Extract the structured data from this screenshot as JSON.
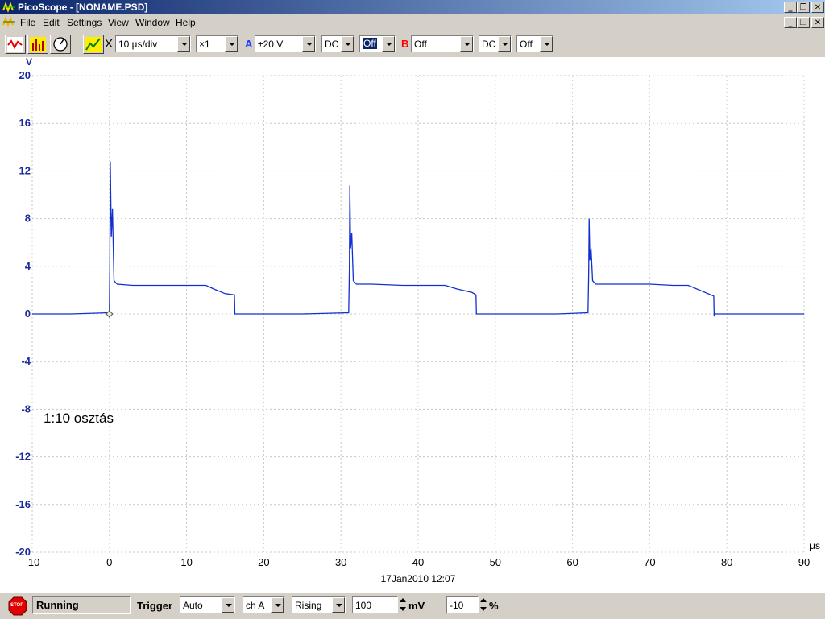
{
  "window": {
    "title": "PicoScope - [NONAME.PSD]",
    "controls": {
      "minimize": "_",
      "restore": "❐",
      "close": "✕"
    }
  },
  "menu": {
    "items": [
      "File",
      "Edit",
      "Settings",
      "View",
      "Window",
      "Help"
    ]
  },
  "toolbar": {
    "timebase_marker": "X",
    "timebase": "10 µs/div",
    "zoom": "×1",
    "channel_a": {
      "label": "A",
      "color": "#1a3cff",
      "range": "±20 V",
      "coupling": "DC",
      "option": "Off"
    },
    "channel_b": {
      "label": "B",
      "color": "#ff0000",
      "range": "Off",
      "coupling": "DC",
      "option": "Off"
    }
  },
  "chart_data": {
    "type": "line",
    "y_unit": "V",
    "x_unit": "µs",
    "xlim": [
      -10,
      90
    ],
    "ylim": [
      -20,
      20
    ],
    "x_ticks": [
      -10,
      0,
      10,
      20,
      30,
      40,
      50,
      60,
      70,
      80,
      90
    ],
    "y_ticks": [
      20,
      16,
      12,
      8,
      4,
      0,
      -4,
      -8,
      -12,
      -16,
      -20
    ],
    "grid": true,
    "annotation": "1:10 osztás",
    "timestamp": "17Jan2010  12:07",
    "trigger_marker": {
      "x": 0,
      "y": 0
    },
    "series": [
      {
        "color": "#1030d0",
        "x": [
          -10,
          -5,
          0,
          0.05,
          0.12,
          0.25,
          0.4,
          0.6,
          1,
          3,
          6,
          10,
          12.5,
          13.5,
          15,
          16.2,
          16.25,
          20,
          25,
          31,
          31.1,
          31.15,
          31.25,
          31.4,
          31.6,
          32,
          34,
          38,
          42,
          43.5,
          45,
          47,
          47.5,
          47.55,
          52,
          58,
          62,
          62.1,
          62.15,
          62.25,
          62.4,
          62.6,
          63,
          65,
          70,
          73,
          75,
          78.3,
          78.35,
          78.5,
          80,
          85,
          90
        ],
        "y": [
          0,
          0,
          0.1,
          4,
          12.8,
          6.5,
          8.8,
          2.8,
          2.5,
          2.4,
          2.4,
          2.4,
          2.4,
          2.1,
          1.7,
          1.6,
          0,
          0,
          0,
          0.1,
          4,
          10.8,
          5.5,
          6.8,
          2.8,
          2.5,
          2.5,
          2.4,
          2.4,
          2.4,
          2.1,
          1.8,
          1.6,
          0,
          0,
          0,
          0.1,
          3.5,
          8,
          4.5,
          5.5,
          2.8,
          2.5,
          2.5,
          2.5,
          2.4,
          2.4,
          1.5,
          -0.2,
          0,
          0,
          0,
          0
        ]
      }
    ]
  },
  "status": {
    "stop_icon_text": "STOP",
    "run_state": "Running",
    "trigger_label": "Trigger",
    "trigger_mode": "Auto",
    "trigger_channel": "ch A",
    "trigger_edge": "Rising",
    "threshold_value": "100",
    "threshold_unit": "mV",
    "delay_value": "-10",
    "delay_unit": "%"
  }
}
